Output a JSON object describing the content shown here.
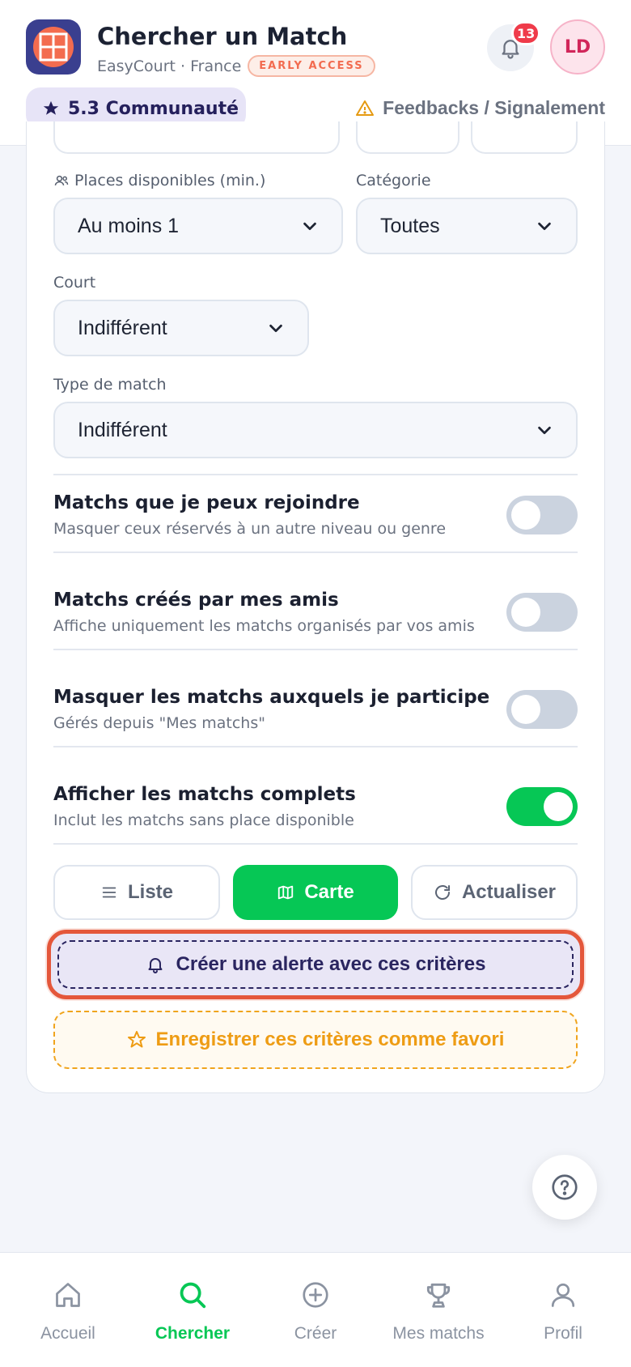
{
  "header": {
    "title": "Chercher un Match",
    "subtitle": "EasyCourt · France",
    "badge": "EARLY ACCESS",
    "notifications_count": "13",
    "avatar_initials": "LD",
    "community_label": "5.3 Communauté",
    "feedback_label": "Feedbacks / Signalement"
  },
  "filters": {
    "places_label": "Places disponibles (min.)",
    "places_value": "Au moins 1",
    "category_label": "Catégorie",
    "category_value": "Toutes",
    "court_label": "Court",
    "court_value": "Indifférent",
    "match_type_label": "Type de match",
    "match_type_value": "Indifférent"
  },
  "toggles": [
    {
      "title": "Matchs que je peux rejoindre",
      "desc": "Masquer ceux réservés à un autre niveau ou genre",
      "on": false
    },
    {
      "title": "Matchs créés par mes amis",
      "desc": "Affiche uniquement les matchs organisés par vos amis",
      "on": false
    },
    {
      "title": "Masquer les matchs auxquels je participe",
      "desc": "Gérés depuis \"Mes matchs\"",
      "on": false
    },
    {
      "title": "Afficher les matchs complets",
      "desc": "Inclut les matchs sans place disponible",
      "on": true
    }
  ],
  "views": {
    "list": "Liste",
    "map": "Carte",
    "refresh": "Actualiser"
  },
  "actions": {
    "create_alert": "Créer une alerte avec ces critères",
    "save_favorite": "Enregistrer ces critères comme favori"
  },
  "nav": {
    "home": "Accueil",
    "search": "Chercher",
    "create": "Créer",
    "my_matches": "Mes matchs",
    "profile": "Profil"
  },
  "colors": {
    "primary_green": "#06c755",
    "brand_indigo": "#3a3f8f",
    "accent_orange": "#f36c4f",
    "alert_red": "#ef3b4a",
    "favorite_amber": "#ee9c14"
  }
}
